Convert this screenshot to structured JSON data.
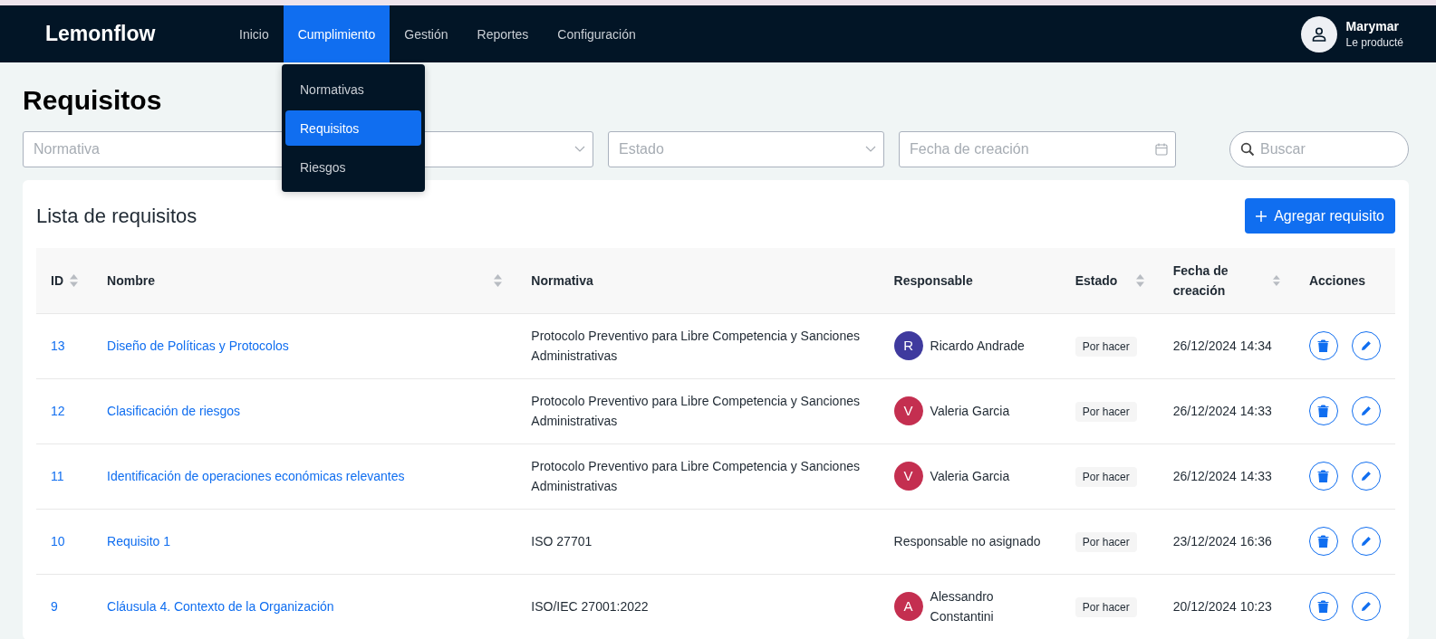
{
  "app": {
    "logo": "Lemonflow"
  },
  "nav": [
    {
      "label": "Inicio",
      "selected": false
    },
    {
      "label": "Cumplimiento",
      "selected": true
    },
    {
      "label": "Gestión",
      "selected": false
    },
    {
      "label": "Reportes",
      "selected": false
    },
    {
      "label": "Configuración",
      "selected": false
    }
  ],
  "user": {
    "name": "Marymar",
    "subtitle": "Le producté"
  },
  "dropdown_menu": [
    {
      "label": "Normativas",
      "selected": false
    },
    {
      "label": "Requisitos",
      "selected": true
    },
    {
      "label": "Riesgos",
      "selected": false
    }
  ],
  "page_title": "Requisitos",
  "filters": [
    {
      "kind": "select",
      "placeholder": "Normativa"
    },
    {
      "kind": "select"
    },
    {
      "kind": "select",
      "placeholder": "Estado"
    },
    {
      "kind": "date",
      "placeholder": "Fecha de creación"
    },
    {
      "kind": "search",
      "placeholder": "Buscar"
    }
  ],
  "card": {
    "title": "Lista de requisitos",
    "add_button": "Agregar requisito"
  },
  "table": {
    "columns": [
      {
        "label": "ID",
        "sortable": true
      },
      {
        "label": "Nombre",
        "sortable": true
      },
      {
        "label": "Normativa",
        "sortable": false
      },
      {
        "label": "Responsable",
        "sortable": false
      },
      {
        "label": "Estado",
        "sortable": true
      },
      {
        "label": "Fecha de creación",
        "sortable": true
      },
      {
        "label": "Acciones",
        "sortable": false
      }
    ],
    "rows": [
      {
        "id": "13",
        "name": "Diseño de Políticas y Protocolos",
        "normativa": "Protocolo Preventivo para Libre Competencia y Sanciones Administrativas",
        "responsable": {
          "initial": "R",
          "name": "Ricardo Andrade",
          "color": "#3f3a9e"
        },
        "estado": "Por hacer",
        "fecha": "26/12/2024 14:34"
      },
      {
        "id": "12",
        "name": "Clasificación de riesgos",
        "normativa": "Protocolo Preventivo para Libre Competencia y Sanciones Administrativas",
        "responsable": {
          "initial": "V",
          "name": "Valeria Garcia",
          "color": "#c42f50"
        },
        "estado": "Por hacer",
        "fecha": "26/12/2024 14:33"
      },
      {
        "id": "11",
        "name": "Identificación de operaciones económicas relevantes",
        "normativa": "Protocolo Preventivo para Libre Competencia y Sanciones Administrativas",
        "responsable": {
          "initial": "V",
          "name": "Valeria Garcia",
          "color": "#c42f50"
        },
        "estado": "Por hacer",
        "fecha": "26/12/2024 14:33"
      },
      {
        "id": "10",
        "name": "Requisito 1",
        "normativa": "ISO 27701",
        "responsable": {
          "name": "Responsable no asignado"
        },
        "estado": "Por hacer",
        "fecha": "23/12/2024 16:36"
      },
      {
        "id": "9",
        "name": "Cláusula 4. Contexto de la Organización",
        "normativa": "ISO/IEC 27001:2022",
        "responsable": {
          "initial": "A",
          "name": "Alessandro Constantini",
          "color": "#c42f50"
        },
        "estado": "Por hacer",
        "fecha": "20/12/2024 10:23"
      }
    ]
  }
}
